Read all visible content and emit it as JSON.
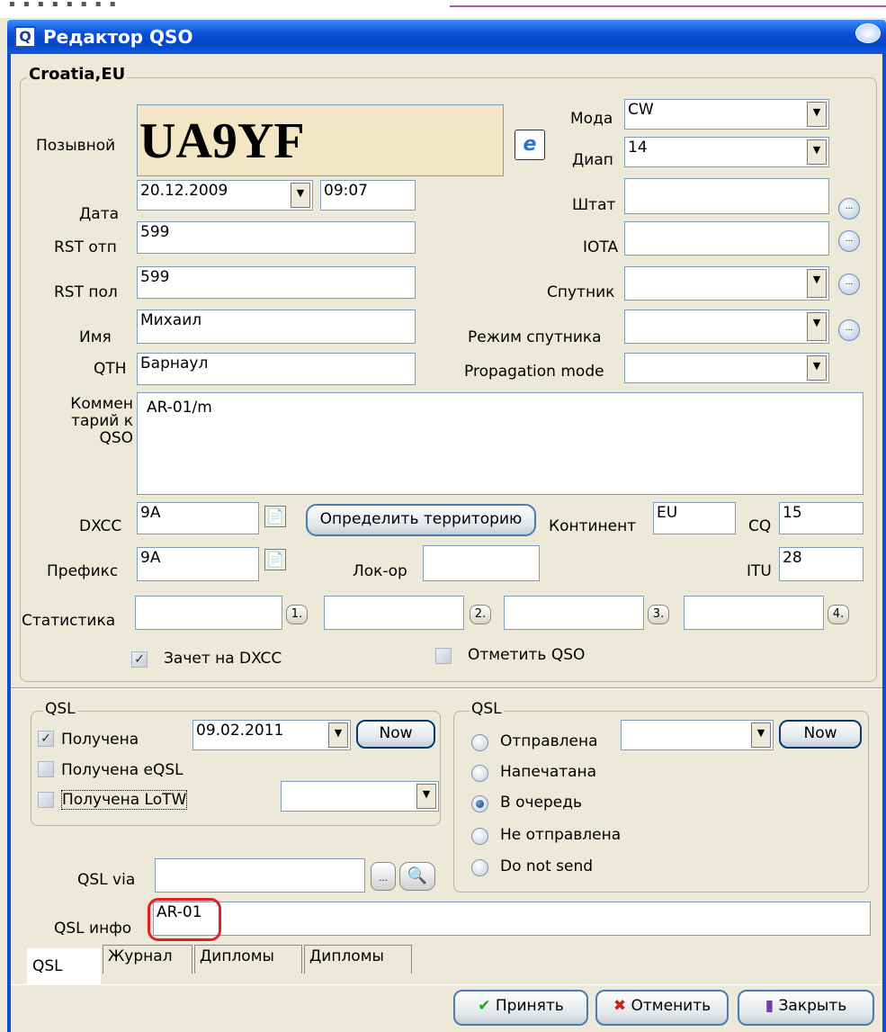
{
  "window": {
    "title": "Редактор QSO"
  },
  "country": "Croatia,EU",
  "callsign": {
    "label": "Позывной",
    "value": "UA9YF"
  },
  "date": {
    "label": "Дата",
    "value": "20.12.2009",
    "time": "09:07"
  },
  "rst_sent": {
    "label": "RST отп",
    "value": "599"
  },
  "rst_rcvd": {
    "label": "RST пол",
    "value": "599"
  },
  "name": {
    "label": "Имя",
    "value": "Михаил"
  },
  "qth": {
    "label": "QTH",
    "value": "Барнаул"
  },
  "comment": {
    "label_lines": [
      "Коммен",
      "тарий к",
      "QSO"
    ],
    "value": "AR-01/m"
  },
  "mode": {
    "label": "Мода",
    "value": "CW"
  },
  "band": {
    "label": "Диап",
    "value": "14"
  },
  "state": {
    "label": "Штат",
    "value": ""
  },
  "iota": {
    "label": "IOTA",
    "value": ""
  },
  "satellite": {
    "label": "Спутник",
    "value": ""
  },
  "sat_mode": {
    "label": "Режим спутника",
    "value": ""
  },
  "propagation": {
    "label": "Propagation mode",
    "value": ""
  },
  "dxcc": {
    "label": "DXCC",
    "value": "9A",
    "detect_button": "Определить территорию"
  },
  "continent": {
    "label": "Континент",
    "value": "EU"
  },
  "cq": {
    "label": "CQ",
    "value": "15"
  },
  "prefix": {
    "label": "Префикс",
    "value": "9A"
  },
  "locator": {
    "label": "Лок-ор",
    "value": ""
  },
  "itu": {
    "label": "ITU",
    "value": "28"
  },
  "stats": {
    "label": "Статистика",
    "buttons": [
      "1.",
      "2.",
      "3.",
      "4."
    ]
  },
  "dxcc_credit": {
    "label": "Зачет на DXCC",
    "checked": true
  },
  "mark_qso": {
    "label": "Отметить QSO",
    "checked": false
  },
  "qsl_received": {
    "caption": "QSL",
    "received": {
      "label": "Получена",
      "checked": true,
      "date": "09.02.2011"
    },
    "now_button": "Now",
    "eqsl": {
      "label": "Получена eQSL",
      "checked": false
    },
    "lotw": {
      "label": "Получена LoTW",
      "checked": false,
      "value": ""
    }
  },
  "qsl_sent": {
    "caption": "QSL",
    "options": [
      {
        "label": "Отправлена",
        "selected": false
      },
      {
        "label": "Напечатана",
        "selected": false
      },
      {
        "label": "В очередь",
        "selected": true
      },
      {
        "label": "Не отправлена",
        "selected": false
      },
      {
        "label": "Do not send",
        "selected": false
      }
    ],
    "now_button": "Now"
  },
  "qsl_via": {
    "label": "QSL via",
    "value": ""
  },
  "qsl_info": {
    "label": "QSL инфо",
    "value": "AR-01"
  },
  "tabs": [
    "QSL",
    "Журнал",
    "Дипломы",
    "Дипломы"
  ],
  "buttons": {
    "accept": "Принять",
    "cancel": "Отменить",
    "close": "Закрыть"
  },
  "colors": {
    "titlebar": "#0a4fd6",
    "callsign_bg": "#f2e6c4",
    "highlight": "#e0202a"
  }
}
